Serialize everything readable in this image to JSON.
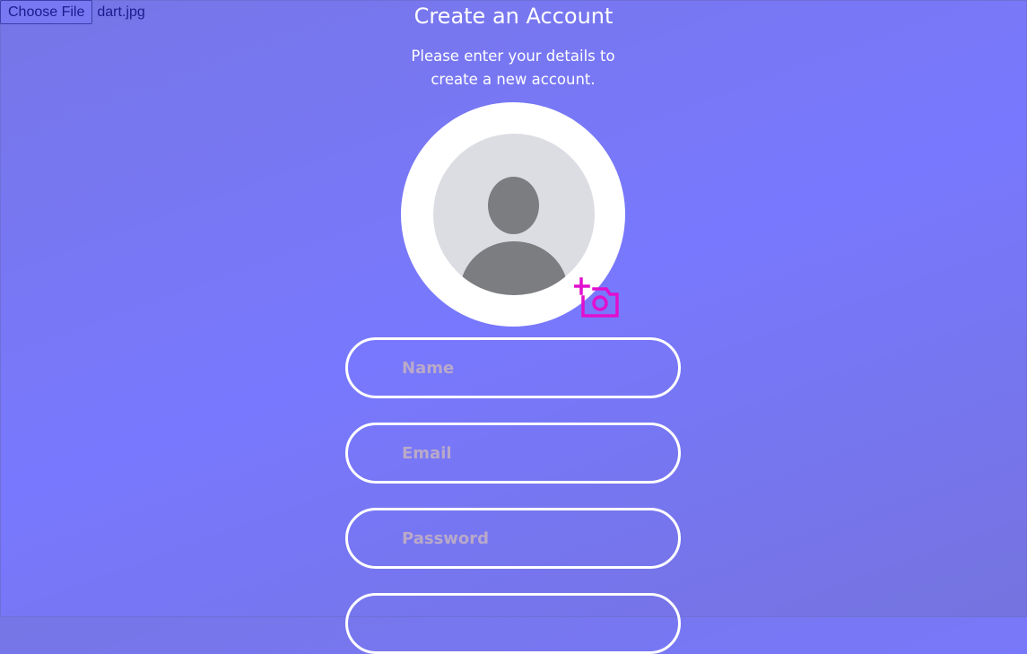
{
  "file_input": {
    "button_label": "Choose File",
    "file_name": "dart.jpg"
  },
  "header": {
    "title": "Create an Account",
    "subtitle": "Please enter your details to create a new account."
  },
  "avatar": {
    "icon": "user-placeholder-icon",
    "add_photo_icon": "add-photo-camera-icon"
  },
  "form": {
    "fields": [
      {
        "placeholder": "Name"
      },
      {
        "placeholder": "Email"
      },
      {
        "placeholder": "Password"
      },
      {
        "placeholder": ""
      }
    ]
  },
  "colors": {
    "background": "#7878fe",
    "accent": "#e10fce",
    "field_border": "#ffffff",
    "placeholder": "#b9a9c9"
  }
}
